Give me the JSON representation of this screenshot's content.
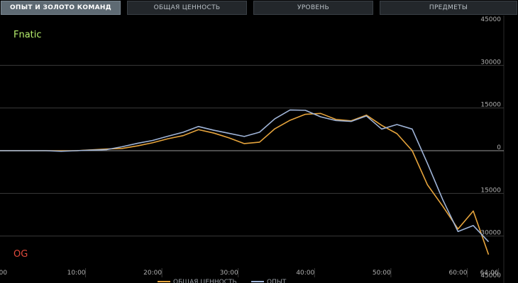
{
  "tabs": [
    {
      "label": "ОПЫТ И ЗОЛОТО КОМАНД",
      "active": true
    },
    {
      "label": "ОБЩАЯ ЦЕННОСТЬ",
      "active": false
    },
    {
      "label": "УРОВЕНЬ",
      "active": false
    },
    {
      "label": "ПРЕДМЕТЫ",
      "active": false
    }
  ],
  "colors": {
    "networth": "#e6a43c",
    "xp": "#9fb4d8",
    "top_team": "#b7ef6c",
    "bottom_team": "#e04a3c"
  },
  "chart_data": {
    "type": "line",
    "title": "",
    "top_team": "Fnatic",
    "bottom_team": "OG",
    "x_tick_labels": [
      "0:00",
      "10:00",
      "20:00",
      "30:00",
      "40:00",
      "50:00",
      "60:00",
      "64:06"
    ],
    "y_tick_labels": [
      "45000",
      "30000",
      "15000",
      "0",
      "15000",
      "30000",
      "45000"
    ],
    "ylim": [
      -45000,
      45000
    ],
    "xlim_minutes": [
      0,
      66
    ],
    "grid": true,
    "legend_position": "bottom-center",
    "x_minutes": [
      0,
      2,
      4,
      6,
      8,
      10,
      12,
      14,
      16,
      18,
      20,
      22,
      24,
      26,
      28,
      30,
      32,
      34,
      36,
      38,
      40,
      42,
      44,
      46,
      48,
      50,
      52,
      54,
      56,
      58,
      60,
      62,
      64
    ],
    "series": [
      {
        "name": "ОБЩАЯ ЦЕННОСТЬ",
        "key": "networth",
        "values": [
          0,
          0,
          0,
          0,
          0,
          0,
          300,
          600,
          800,
          1700,
          2800,
          4200,
          5300,
          7400,
          6200,
          4500,
          2500,
          3000,
          7700,
          10700,
          12800,
          13100,
          11000,
          10500,
          12500,
          8900,
          6000,
          0,
          -12000,
          -19500,
          -27500,
          -21200,
          -36500
        ]
      },
      {
        "name": "ОПЫТ",
        "key": "xp",
        "values": [
          0,
          0,
          0,
          0,
          -200,
          0,
          200,
          400,
          1400,
          2600,
          3600,
          5100,
          6500,
          8500,
          7200,
          6100,
          5000,
          6500,
          11200,
          14300,
          14200,
          11900,
          10600,
          10300,
          12200,
          7600,
          9200,
          7600,
          -4500,
          -17200,
          -28400,
          -26300,
          -32000
        ]
      }
    ]
  }
}
